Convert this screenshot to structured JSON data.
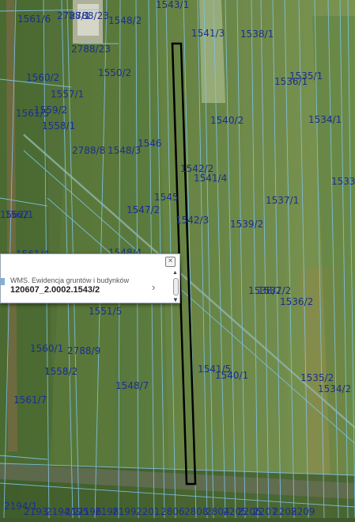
{
  "map": {
    "plot_labels": [
      "1561/6",
      "2788/1",
      "2788/23",
      "1548/2",
      "1543/1",
      "1541/3",
      "1538/1",
      "2788/23",
      "1550/2",
      "1535/1",
      "1536/1",
      "1560/2",
      "1557/1",
      "1559/2",
      "1561/5",
      "1558/1",
      "1540/2",
      "1534/1",
      "2788/8",
      "1548/3",
      "1546",
      "1542/2",
      "1541/4",
      "1533",
      "1545",
      "1547/2",
      "1537/1",
      "1562",
      "1542/3",
      "1539/2",
      "1561/4",
      "1548/4",
      "1538/2",
      "1537/2",
      "1536/2",
      "1551/5",
      "1560/1",
      "2788/9",
      "1558/2",
      "1541/5",
      "1540/1",
      "1535/2",
      "1548/7",
      "1534/2",
      "1561/7",
      "2194/1",
      "2193",
      "2194/2",
      "2195",
      "2196",
      "2198",
      "2199",
      "2201",
      "2806",
      "2808",
      "2804",
      "2205",
      "2206",
      "2207",
      "2208",
      "2209",
      "1562/1"
    ],
    "highlight_color": "#000000",
    "boundary_color": "#7fc4e8",
    "label_color": "#1a2f8f"
  },
  "popup": {
    "layer_name": "WMS. Ewidencja gruntów i budynków",
    "feature_id": "120607_2.0002.1543/2",
    "close_icon": "×",
    "next_icon": "›",
    "scroll_up_icon": "▲",
    "scroll_down_icon": "▼"
  }
}
